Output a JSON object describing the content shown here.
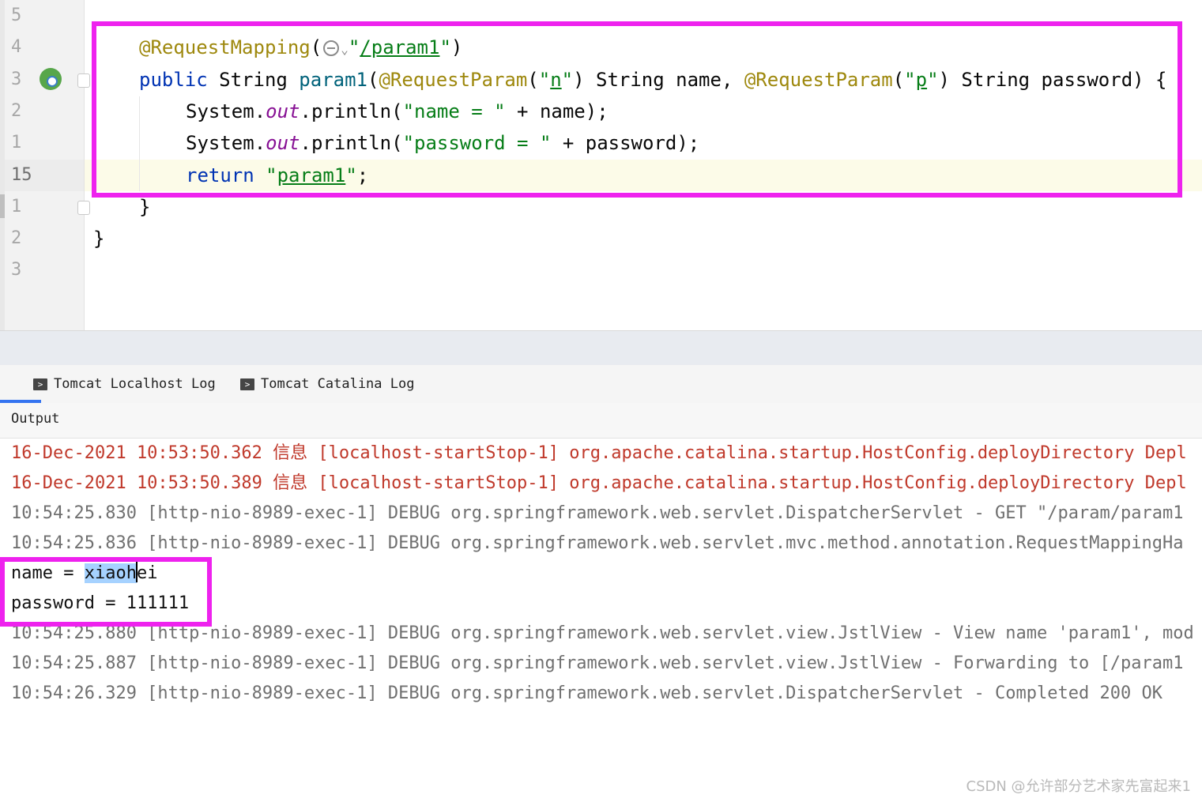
{
  "editor": {
    "line_numbers": [
      "5",
      "4",
      "3",
      "2",
      "1",
      "15",
      "1",
      "2",
      "3"
    ],
    "code": {
      "l1_annotation": "@RequestMapping",
      "l1_open": "(",
      "l1_str_q1": "\"",
      "l1_path": "/param1",
      "l1_str_q2": "\"",
      "l1_close": ")",
      "l2_public": "public",
      "l2_string": " String ",
      "l2_method": "param1",
      "l2_paren": "(",
      "l2_ann1": "@RequestParam",
      "l2_p1_open": "(",
      "l2_q1": "\"",
      "l2_n": "n",
      "l2_q2": "\"",
      "l2_p1_close": ") String name, ",
      "l2_ann2": "@RequestParam",
      "l2_p2_open": "(",
      "l2_q3": "\"",
      "l2_p": "p",
      "l2_q4": "\"",
      "l2_p2_close": ") String password) {",
      "l3_system": "System.",
      "l3_out": "out",
      "l3_println": ".println(",
      "l3_str": "\"name = \"",
      "l3_rest": " + name);",
      "l4_system": "System.",
      "l4_out": "out",
      "l4_println": ".println(",
      "l4_str": "\"password = \"",
      "l4_rest": " + password);",
      "l5_return": "return",
      "l5_space": " ",
      "l5_q1": "\"",
      "l5_val": "param1",
      "l5_q2": "\"",
      "l5_semi": ";",
      "l6": "}",
      "l7": "}"
    }
  },
  "tabs": [
    {
      "label": "Tomcat Localhost Log"
    },
    {
      "label": "Tomcat Catalina Log"
    }
  ],
  "output": {
    "label": "Output",
    "lines": [
      "16-Dec-2021 10:53:50.362 信息 [localhost-startStop-1] org.apache.catalina.startup.HostConfig.deployDirectory Depl",
      "16-Dec-2021 10:53:50.389 信息 [localhost-startStop-1] org.apache.catalina.startup.HostConfig.deployDirectory Depl",
      "10:54:25.830 [http-nio-8989-exec-1] DEBUG org.springframework.web.servlet.DispatcherServlet - GET \"/param/param1",
      "10:54:25.836 [http-nio-8989-exec-1] DEBUG org.springframework.web.servlet.mvc.method.annotation.RequestMappingHa"
    ],
    "name_prefix": "name = ",
    "name_selected": "xiaoh",
    "name_rest": "ei",
    "password_line": "password = 111111",
    "lines_after": [
      "10:54:25.880 [http-nio-8989-exec-1] DEBUG org.springframework.web.servlet.view.JstlView - View name 'param1', mod",
      "10:54:25.887 [http-nio-8989-exec-1] DEBUG org.springframework.web.servlet.view.JstlView - Forwarding to [/param1",
      "10:54:26.329 [http-nio-8989-exec-1] DEBUG org.springframework.web.servlet.DispatcherServlet - Completed 200 OK"
    ]
  },
  "watermark": "CSDN @允许部分艺术家先富起来1",
  "colors": {
    "highlight": "#ee22ee",
    "annotation": "#9e880d",
    "keyword": "#0033b3",
    "string": "#067d17",
    "log_info": "#c0392b",
    "log_debug": "#707070"
  }
}
